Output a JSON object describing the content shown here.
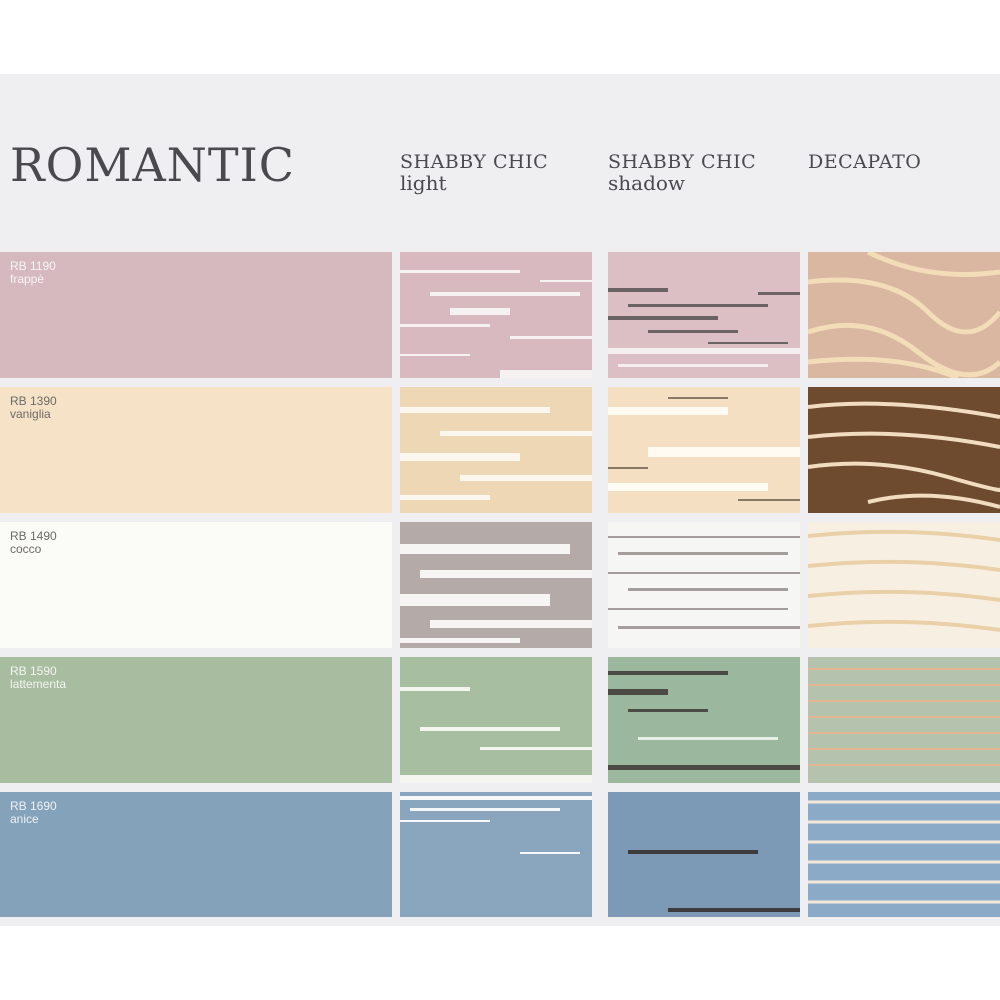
{
  "title": "ROMANTIC",
  "columns": [
    {
      "line1": "SHABBY CHIC",
      "line2": "light"
    },
    {
      "line1": "SHABBY CHIC",
      "line2": "shadow"
    },
    {
      "line1": "DECAPATO",
      "line2": ""
    }
  ],
  "colors": [
    {
      "code": "RB 1190",
      "name": "frappè",
      "hex": "#d6b9be",
      "finishes": [
        "plain",
        "shabby-light",
        "shabby-shadow",
        "decapato"
      ]
    },
    {
      "code": "RB 1390",
      "name": "vaniglia",
      "hex": "#f6e2c6"
    },
    {
      "code": "RB 1490",
      "name": "cocco",
      "hex": "#fbfbf8"
    },
    {
      "code": "RB 1590",
      "name": "lattementa",
      "hex": "#a8bc9f"
    },
    {
      "code": "RB 1690",
      "name": "anice",
      "hex": "#85a2bb"
    }
  ]
}
